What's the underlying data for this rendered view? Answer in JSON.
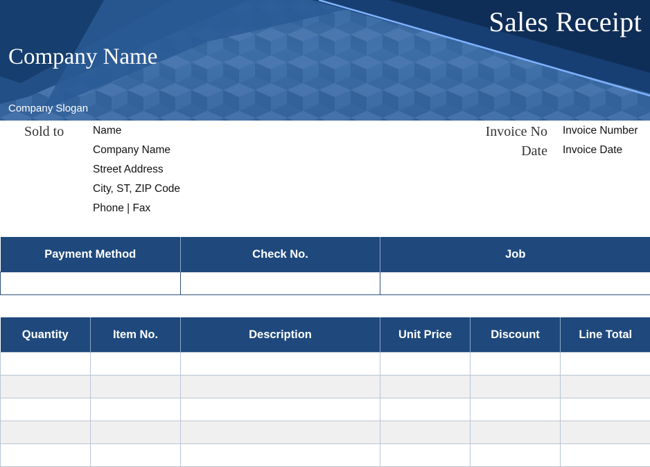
{
  "header": {
    "title": "Sales Receipt",
    "company_name": "Company Name",
    "slogan": "Company Slogan"
  },
  "sold_to": {
    "label": "Sold to",
    "lines": [
      "Name",
      "Company Name",
      "Street Address",
      "City, ST,  ZIP Code",
      "Phone  |  Fax"
    ]
  },
  "invoice": {
    "number_label": "Invoice No",
    "number_value": "Invoice Number",
    "date_label": "Date",
    "date_value": "Invoice Date"
  },
  "payment_table": {
    "headers": [
      "Payment Method",
      "Check No.",
      "Job"
    ]
  },
  "items_table": {
    "headers": [
      "Quantity",
      "Item No.",
      "Description",
      "Unit Price",
      "Discount",
      "Line Total"
    ]
  },
  "colors": {
    "header_fill": "#1f497d",
    "banner_blue": "#3d6ea6",
    "row_alt": "#f0f0f0"
  }
}
